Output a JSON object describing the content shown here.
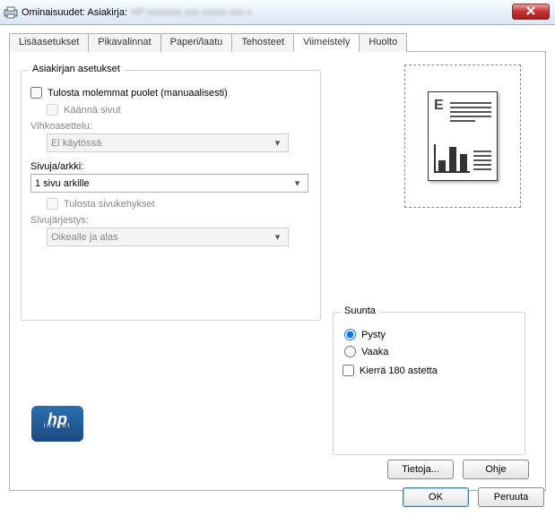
{
  "window": {
    "title": "Ominaisuudet: Asiakirja:"
  },
  "tabs": {
    "items": [
      {
        "label": "Lisäasetukset"
      },
      {
        "label": "Pikavalinnat"
      },
      {
        "label": "Paperi/laatu"
      },
      {
        "label": "Tehosteet"
      },
      {
        "label": "Viimeistely"
      },
      {
        "label": "Huolto"
      }
    ],
    "active_index": 4
  },
  "doc_settings": {
    "legend": "Asiakirjan asetukset",
    "print_both": "Tulosta molemmat puolet (manuaalisesti)",
    "flip_pages": "Käännä sivut",
    "booklet_label": "Vihkoasettelu:",
    "booklet_value": "Ei käytössä",
    "pages_per_sheet_label": "Sivuja/arkki:",
    "pages_per_sheet_value": "1 sivu arkille",
    "print_borders": "Tulosta sivukehykset",
    "page_order_label": "Sivujärjestys:",
    "page_order_value": "Oikealle ja alas"
  },
  "orientation": {
    "legend": "Suunta",
    "portrait": "Pysty",
    "landscape": "Vaaka",
    "rotate": "Kierrä 180 astetta"
  },
  "buttons": {
    "about": "Tietoja...",
    "help": "Ohje",
    "ok": "OK",
    "cancel": "Peruuta"
  }
}
